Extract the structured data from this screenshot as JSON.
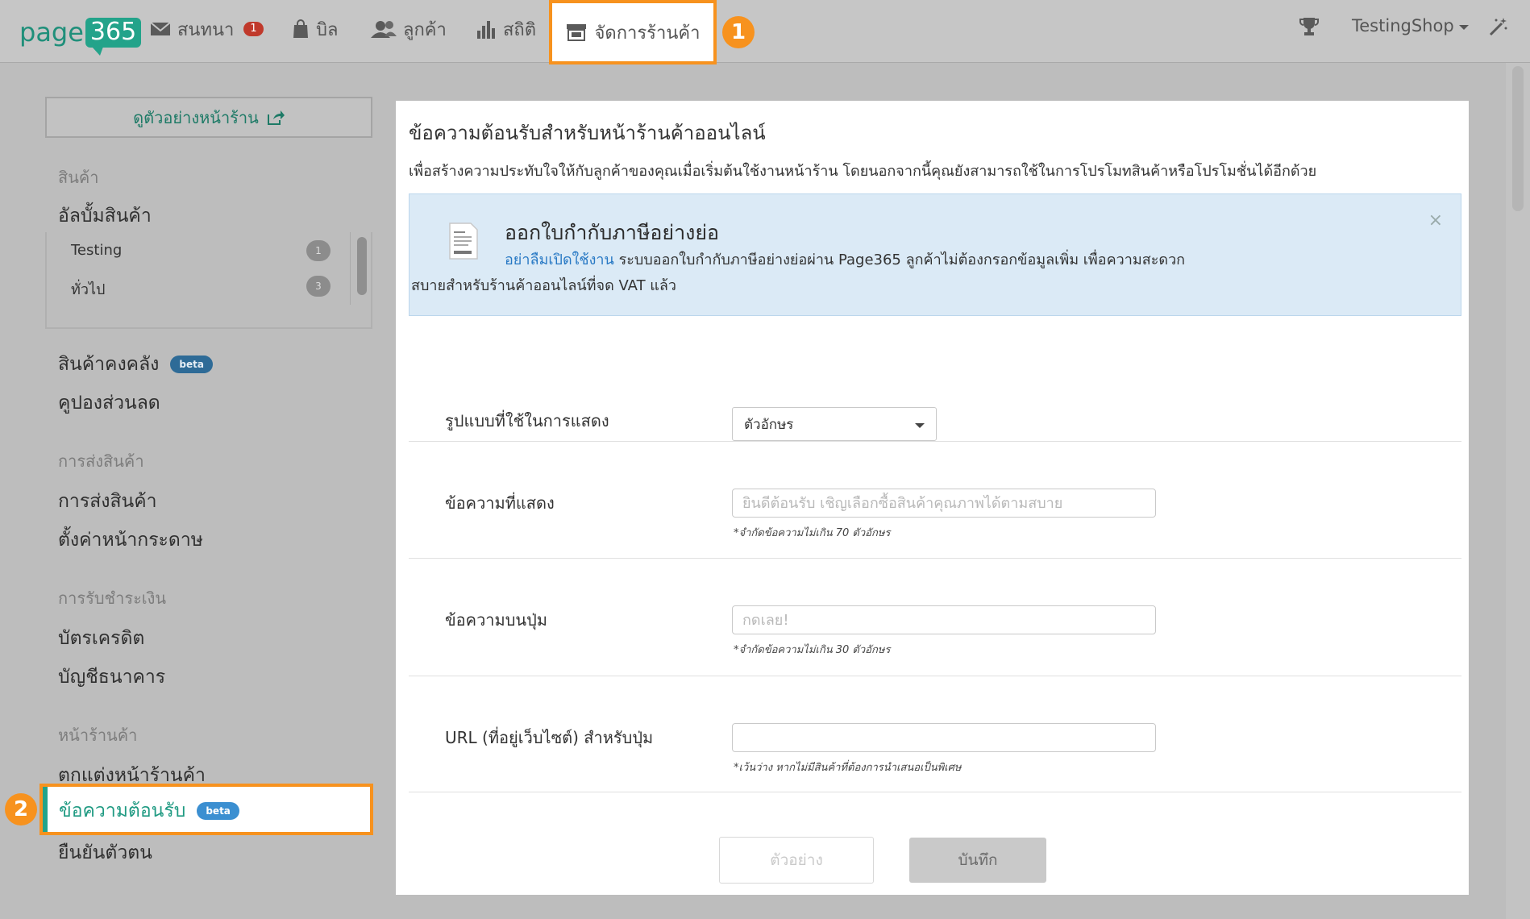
{
  "logo": {
    "word": "page",
    "num": "365"
  },
  "nav": {
    "chat": {
      "label": "สนทนา",
      "badge": "1"
    },
    "bill": {
      "label": "บิล"
    },
    "customer": {
      "label": "ลูกค้า"
    },
    "stats": {
      "label": "สถิติ"
    },
    "shop": {
      "label": "จัดการร้านค้า"
    },
    "shop_name": "TestingShop"
  },
  "steps": {
    "one": "1",
    "two": "2"
  },
  "sidebar": {
    "preview_button": "ดูตัวอย่างหน้าร้าน",
    "products_head": "สินค้า",
    "album": "อัลบั้มสินค้า",
    "album_items": [
      {
        "label": "Testing",
        "count": "1"
      },
      {
        "label": "ทั่วไป",
        "count": "3"
      }
    ],
    "inventory": "สินค้าคงคลัง",
    "beta": "beta",
    "coupon": "คูปองส่วนลด",
    "shipping_head": "การส่งสินค้า",
    "shipping": "การส่งสินค้า",
    "paper": "ตั้งค่าหน้ากระดาษ",
    "payment_head": "การรับชำระเงิน",
    "credit": "บัตรเครดิต",
    "bank": "บัญชีธนาคาร",
    "storefront_head": "หน้าร้านค้า",
    "decorate": "ตกแต่งหน้าร้านค้า",
    "welcome": "ข้อความต้อนรับ",
    "verify": "ยืนยันตัวตน"
  },
  "main": {
    "title": "ข้อความต้อนรับสำหรับหน้าร้านค้าออนไลน์",
    "description": "เพื่อสร้างความประทับใจให้กับลูกค้าของคุณเมื่อเริ่มต้นใช้งานหน้าร้าน โดยนอกจากนี้คุณยังสามารถใช้ในการโปรโมทสินค้าหรือโปรโมชั่นได้อีกด้วย",
    "alert": {
      "title": "ออกใบกำกับภาษีอย่างย่อ",
      "link": "อย่าลืมเปิดใช้งาน",
      "line1": " ระบบออกใบกำกับภาษีอย่างย่อผ่าน Page365 ลูกค้าไม่ต้องกรอกข้อมูลเพิ่ม เพื่อความสะดวก",
      "line2": "สบายสำหรับร้านค้าออนไลน์ที่จด VAT แล้ว",
      "close": "×"
    },
    "form": {
      "display_label": "รูปแบบที่ใช้ในการแสดง",
      "display_value": "ตัวอักษร",
      "message_label": "ข้อความที่แสดง",
      "message_placeholder": "ยินดีต้อนรับ เชิญเลือกซื้อสินค้าคุณภาพได้ตามสบาย",
      "message_hint": "*จำกัดข้อความไม่เกิน 70 ตัวอักษร",
      "button_label": "ข้อความบนปุ่ม",
      "button_placeholder": "กดเลย!",
      "button_hint": "*จำกัดข้อความไม่เกิน 30 ตัวอักษร",
      "url_label": "URL (ที่อยู่เว็บไซต์) สำหรับปุ่ม",
      "url_value": "",
      "url_hint": "*เว้นว่าง หากไม่มีสินค้าที่ต้องการนำเสนอเป็นพิเศษ"
    },
    "preview_button": "ตัวอย่าง",
    "save_button": "บันทึก"
  }
}
